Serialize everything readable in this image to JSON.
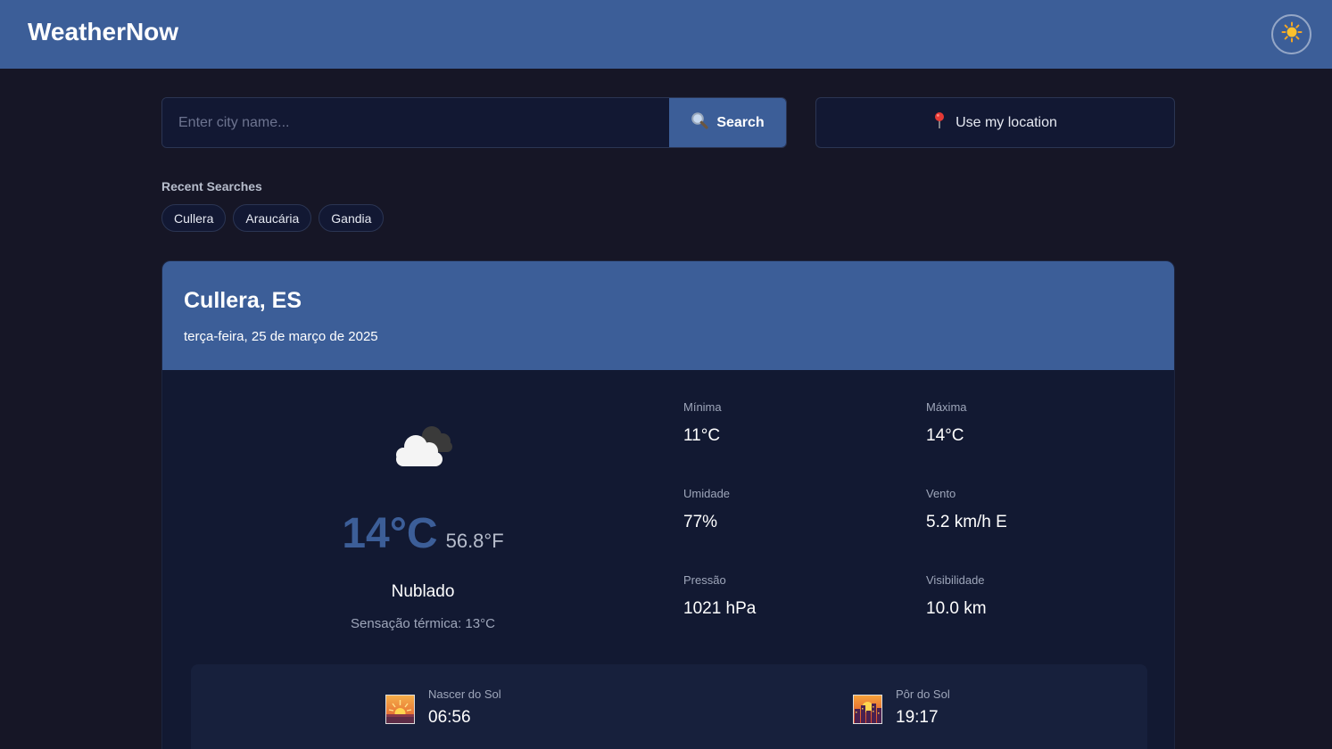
{
  "header": {
    "brand": "WeatherNow",
    "theme_icon": "sun-icon"
  },
  "search": {
    "placeholder": "Enter city name...",
    "value": "",
    "button_label": "Search",
    "button_icon": "magnifier-icon"
  },
  "location_button": {
    "label": "Use my location",
    "icon": "pin-icon"
  },
  "recent": {
    "title": "Recent Searches",
    "items": [
      "Cullera",
      "Araucária",
      "Gandia"
    ]
  },
  "weather": {
    "city": "Cullera, ES",
    "date": "terça-feira, 25 de março de 2025",
    "icon": "cloud-icon",
    "temp_c": "14°C",
    "temp_f": "56.8°F",
    "condition": "Nublado",
    "feels_like": "Sensação térmica: 13°C",
    "stats": {
      "min": {
        "label": "Mínima",
        "value": "11°C"
      },
      "max": {
        "label": "Máxima",
        "value": "14°C"
      },
      "humidity": {
        "label": "Umidade",
        "value": "77%"
      },
      "wind": {
        "label": "Vento",
        "value": "5.2 km/h E"
      },
      "pressure": {
        "label": "Pressão",
        "value": "1021 hPa"
      },
      "visibility": {
        "label": "Visibilidade",
        "value": "10.0 km"
      }
    },
    "sunrise": {
      "label": "Nascer do Sol",
      "value": "06:56",
      "icon": "sunrise-icon"
    },
    "sunset": {
      "label": "Pôr do Sol",
      "value": "19:17",
      "icon": "sunset-icon"
    }
  },
  "colors": {
    "accent": "#3c5e98",
    "background": "#161626",
    "card": "#121932"
  }
}
